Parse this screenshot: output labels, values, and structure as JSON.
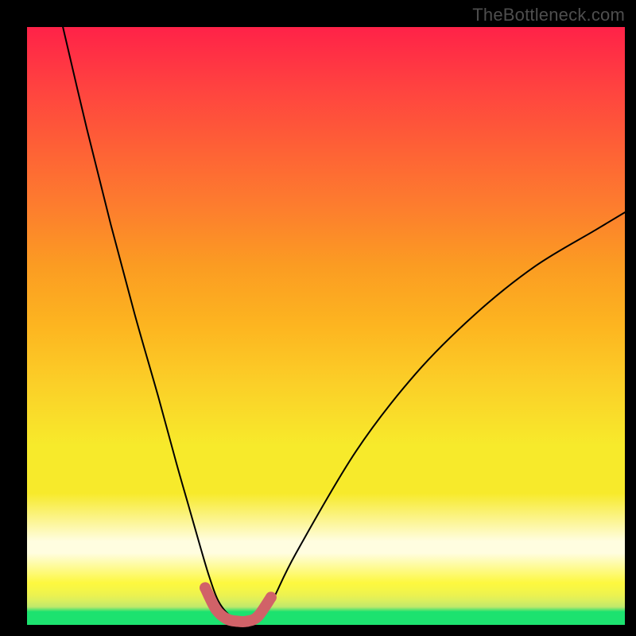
{
  "watermark": "TheBottleneck.com",
  "chart_data": {
    "type": "line",
    "title": "",
    "xlabel": "",
    "ylabel": "",
    "xlim": [
      0,
      100
    ],
    "ylim": [
      0,
      100
    ],
    "grid": false,
    "gradient_bands": [
      {
        "pos": 0,
        "color": "#1ce26f"
      },
      {
        "pos": 12,
        "color": "#fffde0"
      },
      {
        "pos": 30,
        "color": "#f7ea2b"
      },
      {
        "pos": 60,
        "color": "#fb9c22"
      },
      {
        "pos": 100,
        "color": "#ff2248"
      }
    ],
    "series": [
      {
        "name": "bottleneck-curve",
        "color": "#000000",
        "width": 2,
        "x": [
          6,
          10,
          14,
          18,
          22,
          25,
          27,
          29,
          30.5,
          32,
          34,
          36,
          38,
          39,
          41,
          45,
          55,
          65,
          75,
          85,
          95,
          100
        ],
        "values": [
          100,
          83,
          67,
          52,
          38,
          27,
          20,
          13,
          8,
          4,
          1.5,
          0.8,
          0.8,
          1.5,
          4,
          12,
          29,
          42,
          52,
          60,
          66,
          69
        ]
      }
    ],
    "highlight": {
      "name": "bottleneck-highlight",
      "color": "#d16268",
      "x": [
        29.8,
        31.6,
        33.4,
        35.2,
        36.8,
        38.6,
        40.8
      ],
      "values": [
        6.2,
        2.6,
        1.0,
        0.6,
        0.6,
        1.4,
        4.6
      ],
      "thick_stroke": 14,
      "dot_r": 7
    }
  }
}
